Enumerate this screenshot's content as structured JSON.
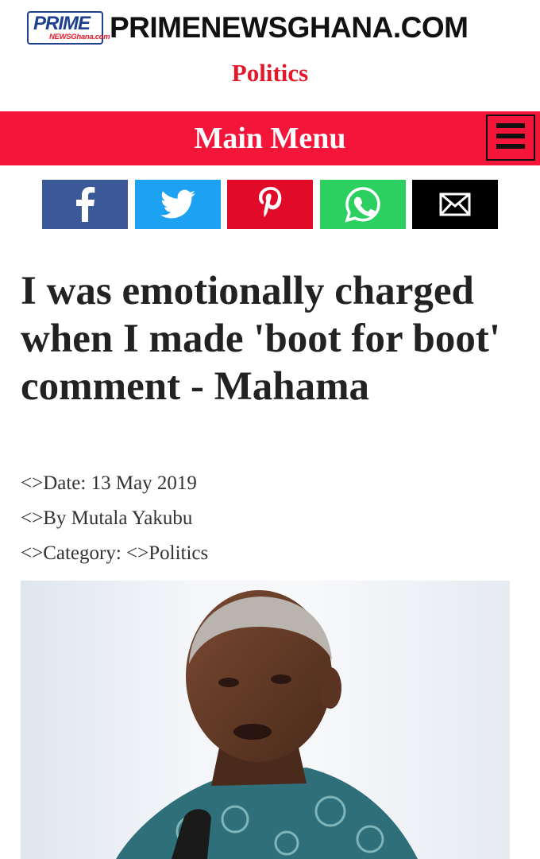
{
  "header": {
    "logo_prime": "PRIME",
    "logo_sub": "NEWSGhana.com",
    "site_name": "PRIMENEWSGHANA.COM",
    "section": "Politics"
  },
  "menu": {
    "title": "Main Menu",
    "icon": "hamburger-menu-icon"
  },
  "share": [
    {
      "network": "facebook",
      "icon": "facebook-icon",
      "color": "#3b5998"
    },
    {
      "network": "twitter",
      "icon": "twitter-bird-icon",
      "color": "#1da1f2"
    },
    {
      "network": "pinterest",
      "icon": "pinterest-icon",
      "color": "#e10a29"
    },
    {
      "network": "whatsapp",
      "icon": "whatsapp-icon",
      "color": "#2bd060"
    },
    {
      "network": "email",
      "icon": "envelope-icon",
      "color": "#000000"
    }
  ],
  "article": {
    "headline": "I was emotionally charged when I made 'boot for boot' comment - Mahama",
    "date_line": "<>Date: 13 May 2019",
    "author_line": "<>By Mutala Yakubu",
    "category_line": "<>Category: <>Politics"
  },
  "colors": {
    "accent_red": "#f4163a",
    "section_red": "#e3192b",
    "logo_blue": "#1f3f8f"
  }
}
